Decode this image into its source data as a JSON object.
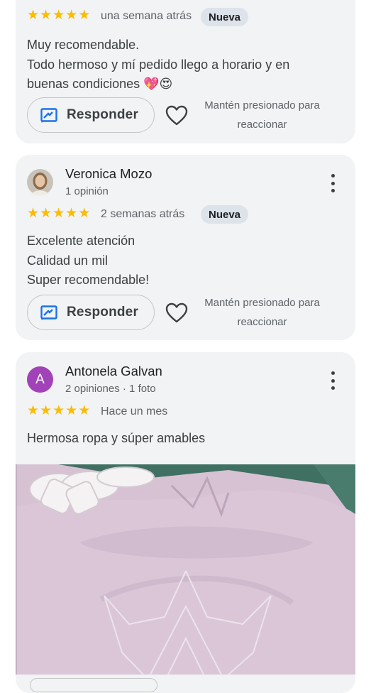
{
  "reviews": [
    {
      "date": "una semana atrás",
      "badge": "Nueva",
      "text_lines": [
        "Muy recomendable.",
        "Todo hermoso y mí pedido llego a horario y en",
        "buenas condiciones 💖😍"
      ],
      "reply_label": "Responder",
      "hint_lines": [
        "Mantén presionado para",
        "reaccionar"
      ],
      "rating": 5
    },
    {
      "name": "Veronica Mozo",
      "meta": "1 opinión",
      "date": "2 semanas atrás",
      "badge": "Nueva",
      "text_lines": [
        "Excelente atención",
        "Calidad un mil",
        "Super recomendable!"
      ],
      "reply_label": "Responder",
      "hint_lines": [
        "Mantén presionado para",
        "reaccionar"
      ],
      "rating": 5
    },
    {
      "name": "Antonela Galvan",
      "avatar_letter": "A",
      "avatar_color": "#a142b8",
      "meta": "2 opiniones · 1 foto",
      "date": "Hace un mes",
      "text_lines": [
        "Hermosa ropa y súper amables"
      ],
      "rating": 5
    }
  ],
  "colors": {
    "card_bg": "#f1f3f4",
    "star": "#fbbc04",
    "badge_bg": "#dde3ea",
    "reply_icon": "#1a73e8"
  },
  "icons": [
    "star-icon",
    "reply-icon",
    "heart-icon",
    "more-vert-icon",
    "avatar"
  ]
}
